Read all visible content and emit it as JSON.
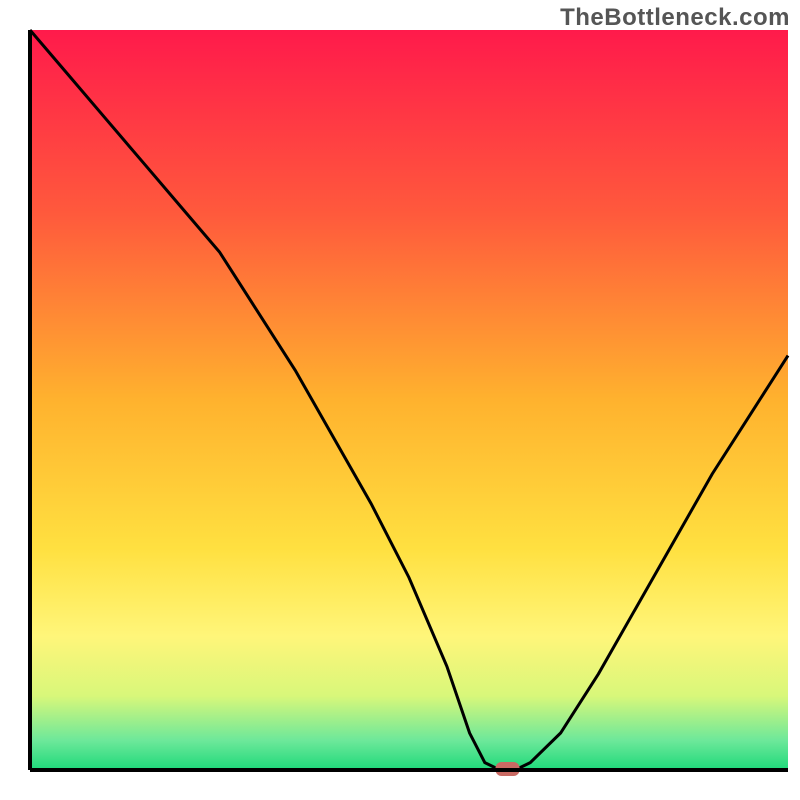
{
  "watermark": "TheBottleneck.com",
  "chart_data": {
    "type": "line",
    "title": "",
    "xlabel": "",
    "ylabel": "",
    "xlim": [
      0,
      100
    ],
    "ylim": [
      0,
      100
    ],
    "x": [
      0,
      5,
      10,
      15,
      20,
      25,
      30,
      35,
      40,
      45,
      50,
      55,
      58,
      60,
      62,
      64,
      66,
      70,
      75,
      80,
      85,
      90,
      95,
      100
    ],
    "values": [
      100,
      94,
      88,
      82,
      76,
      70,
      62,
      54,
      45,
      36,
      26,
      14,
      5,
      1,
      0,
      0,
      1,
      5,
      13,
      22,
      31,
      40,
      48,
      56
    ],
    "marker": {
      "x": 63,
      "y": 0
    },
    "gradient_stops": [
      {
        "offset": 0.0,
        "color": "#ff1a4b"
      },
      {
        "offset": 0.25,
        "color": "#ff5a3c"
      },
      {
        "offset": 0.5,
        "color": "#ffb22e"
      },
      {
        "offset": 0.7,
        "color": "#ffe040"
      },
      {
        "offset": 0.82,
        "color": "#fff67a"
      },
      {
        "offset": 0.9,
        "color": "#d8f77a"
      },
      {
        "offset": 0.96,
        "color": "#6de89a"
      },
      {
        "offset": 1.0,
        "color": "#1ed97a"
      }
    ],
    "curve_color": "#000000",
    "axis_color": "#000000",
    "marker_color": "#c96a63"
  }
}
